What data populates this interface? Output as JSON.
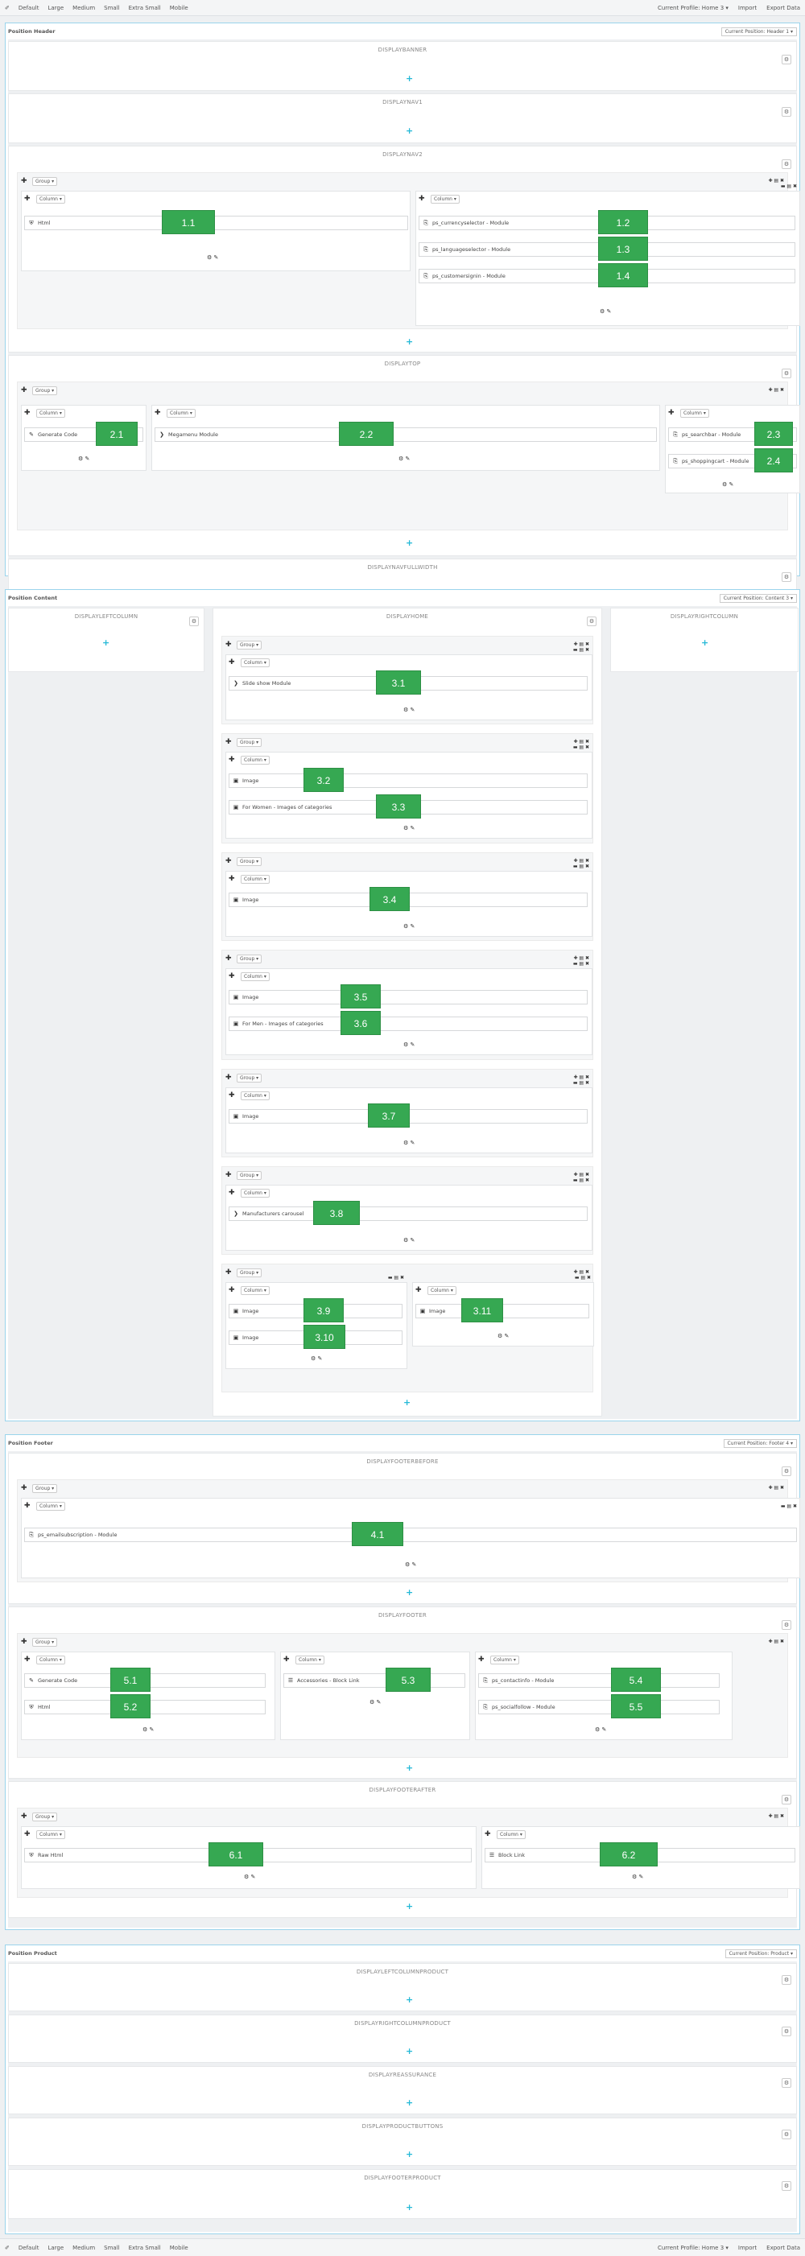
{
  "toolbar": {
    "items": [
      "Default",
      "Large",
      "Medium",
      "Small",
      "Extra Small",
      "Mobile"
    ],
    "right": [
      "Current Profile: Home 3 ▾",
      "Import",
      "Export Data"
    ]
  },
  "labels": {
    "group": "Group ▾",
    "column": "Column ▾",
    "plus": "+",
    "gear": "⚙",
    "tools": "✚ ▤ ✖",
    "colfoot": "⚙ ✎",
    "col_tools": "▬ ▤ ✖",
    "add": "✚"
  },
  "sections": {
    "header": {
      "title": "Position Header",
      "profile": "Current Position: Header 1 ▾",
      "hooks": {
        "banner": "DISPLAYBANNER",
        "nav1": "DISPLAYNAV1",
        "nav2": "DISPLAYNAV2",
        "top": "DISPLAYTOP",
        "navfull": "DISPLAYNAVFULLWIDTH"
      }
    },
    "content": {
      "title": "Position Content",
      "profile": "Current Position: Content 3 ▾",
      "hooks": {
        "left": "DISPLAYLEFTCOLUMN",
        "home": "DISPLAYHOME",
        "right": "DISPLAYRIGHTCOLUMN"
      }
    },
    "footer": {
      "title": "Position Footer",
      "profile": "Current Position: Footer 4 ▾",
      "hooks": {
        "before": "DISPLAYFOOTERBEFORE",
        "footer": "DISPLAYFOOTER",
        "after": "DISPLAYFOOTERAFTER"
      }
    },
    "product": {
      "title": "Position Product",
      "profile": "Current Position: Product ▾",
      "hooks": {
        "leftp": "DISPLAYLEFTCOLUMNPRODUCT",
        "rightp": "DISPLAYRIGHTCOLUMNPRODUCT",
        "reass": "DISPLAYREASSURANCE",
        "buttons": "DISPLAYPRODUCTBUTTONS",
        "footerp": "DISPLAYFOOTERPRODUCT"
      }
    }
  },
  "modules": {
    "m11": {
      "name": "Html",
      "icon": "html5-icon",
      "glyph": "⛨",
      "num": "1.1"
    },
    "m12": {
      "name": "ps_currencyselector - Module",
      "icon": "module-icon",
      "glyph": "⎘",
      "num": "1.2"
    },
    "m13": {
      "name": "ps_languageselector - Module",
      "icon": "module-icon",
      "glyph": "⎘",
      "num": "1.3"
    },
    "m14": {
      "name": "ps_customersignin - Module",
      "icon": "module-icon",
      "glyph": "⎘",
      "num": "1.4"
    },
    "m21": {
      "name": "Generate Code",
      "icon": "code-edit-icon",
      "glyph": "✎",
      "num": "2.1"
    },
    "m22": {
      "name": "Megamenu Module",
      "icon": "chevron-right-icon",
      "glyph": "❯",
      "num": "2.2"
    },
    "m23": {
      "name": "ps_searchbar - Module",
      "icon": "module-icon",
      "glyph": "⎘",
      "num": "2.3"
    },
    "m24": {
      "name": "ps_shoppingcart - Module",
      "icon": "module-icon",
      "glyph": "⎘",
      "num": "2.4"
    },
    "m31": {
      "name": "Slide show Module",
      "icon": "chevron-right-icon",
      "glyph": "❯",
      "num": "3.1"
    },
    "m32": {
      "name": "Image",
      "icon": "image-icon",
      "glyph": "▣",
      "num": "3.2"
    },
    "m33": {
      "name": "For Women - Images of categories",
      "icon": "image-icon",
      "glyph": "▣",
      "num": "3.3"
    },
    "m34": {
      "name": "Image",
      "icon": "image-icon",
      "glyph": "▣",
      "num": "3.4"
    },
    "m35": {
      "name": "Image",
      "icon": "image-icon",
      "glyph": "▣",
      "num": "3.5"
    },
    "m36": {
      "name": "For Men - Images of categories",
      "icon": "image-icon",
      "glyph": "▣",
      "num": "3.6"
    },
    "m37": {
      "name": "Image",
      "icon": "image-icon",
      "glyph": "▣",
      "num": "3.7"
    },
    "m38": {
      "name": "Manufacturers carousel",
      "icon": "chevron-right-icon",
      "glyph": "❯",
      "num": "3.8"
    },
    "m39": {
      "name": "Image",
      "icon": "image-icon",
      "glyph": "▣",
      "num": "3.9"
    },
    "m310": {
      "name": "Image",
      "icon": "image-icon",
      "glyph": "▣",
      "num": "3.10"
    },
    "m311": {
      "name": "Image",
      "icon": "image-icon",
      "glyph": "▣",
      "num": "3.11"
    },
    "m41": {
      "name": "ps_emailsubscription - Module",
      "icon": "module-icon",
      "glyph": "⎘",
      "num": "4.1"
    },
    "m51": {
      "name": "Generate Code",
      "icon": "code-edit-icon",
      "glyph": "✎",
      "num": "5.1"
    },
    "m52": {
      "name": "Html",
      "icon": "html5-icon",
      "glyph": "⛨",
      "num": "5.2"
    },
    "m53": {
      "name": "Accessories - Block Link",
      "icon": "list-icon",
      "glyph": "☰",
      "num": "5.3"
    },
    "m54": {
      "name": "ps_contactinfo - Module",
      "icon": "module-icon",
      "glyph": "⎘",
      "num": "5.4"
    },
    "m55": {
      "name": "ps_socialfollow - Module",
      "icon": "module-icon",
      "glyph": "⎘",
      "num": "5.5"
    },
    "m61": {
      "name": "Raw Html",
      "icon": "html5-icon",
      "glyph": "⛨",
      "num": "6.1"
    },
    "m62": {
      "name": "Block Link",
      "icon": "list-icon",
      "glyph": "☰",
      "num": "6.2"
    }
  },
  "colors": {
    "accent": "#25b9d7",
    "badge": "#36a852",
    "border": "#9ad4ec"
  }
}
